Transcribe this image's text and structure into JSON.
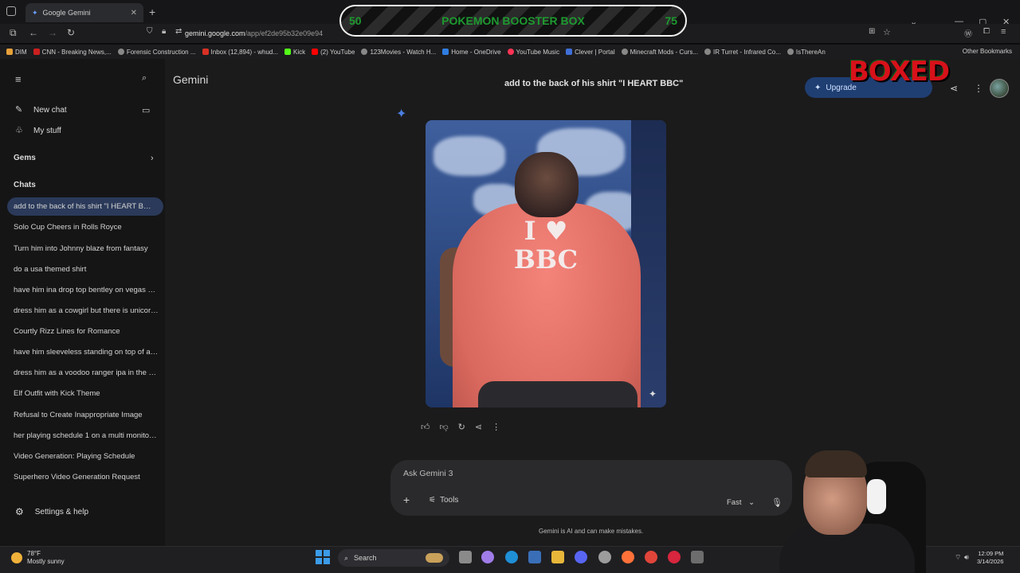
{
  "browser": {
    "tab_title": "Google Gemini",
    "url_prefix": "gemini.google.com",
    "url_rest": "/app/ef2de95b32e09e94",
    "bookmarks": [
      "DIM",
      "CNN - Breaking News,...",
      "Forensic Construction ...",
      "Inbox (12,894) - whud...",
      "Kick",
      "(2) YouTube",
      "123Movies - Watch H...",
      "Home - OneDrive",
      "YouTube Music",
      "Clever | Portal",
      "Minecraft Mods - Curs...",
      "IR Turret - Infrared Co...",
      "IsThereAn"
    ],
    "other_bookmarks": "Other Bookmarks"
  },
  "overlay": {
    "left_count": "50",
    "title": "POKEMON BOOSTER BOX",
    "right_count": "75",
    "logo_text": "BOXED"
  },
  "sidebar": {
    "new_chat": "New chat",
    "my_stuff": "My stuff",
    "gems": "Gems",
    "chats_header": "Chats",
    "chats": [
      "add to the back of his shirt \"I HEART BBC\"",
      "Solo Cup Cheers in Rolls Royce",
      "Turn him into Johnny blaze from fantasy",
      "do a usa themed shirt",
      "have him ina drop top bentley on vegas strip",
      "dress him as a cowgirl but there is unicorns",
      "Courtly Rizz Lines for Romance",
      "have him sleeveless standing on top of a car",
      "dress him as a voodoo ranger ipa in the desert",
      "Elf Outfit with Kick Theme",
      "Refusal to Create Inappropriate Image",
      "her playing schedule 1 on a multi monitor setup",
      "Video Generation: Playing Schedule",
      "Superhero Video Generation Request"
    ],
    "settings": "Settings & help"
  },
  "main": {
    "app_title": "Gemini",
    "prompt": "add to the back of his shirt \"I HEART BBC\"",
    "upgrade_label": "Upgrade",
    "shirt_line1": "I",
    "shirt_heart": "♥",
    "shirt_line2": "BBC",
    "input_placeholder": "Ask Gemini 3",
    "tools": "Tools",
    "mode": "Fast",
    "disclaimer": "Gemini is AI and can make mistakes."
  },
  "taskbar": {
    "temp": "78°F",
    "weather": "Mostly sunny",
    "search": "Search",
    "time": "12:09 PM",
    "date": "3/14/2026"
  },
  "colors": {
    "accent": "#2b3a5a",
    "banner_text": "#1d9a2f",
    "logo": "#d6111a"
  }
}
